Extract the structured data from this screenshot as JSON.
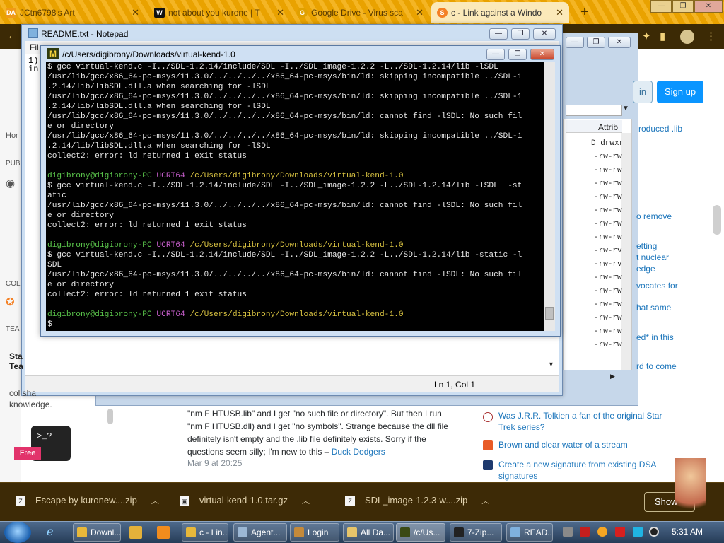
{
  "browser": {
    "tabs": [
      {
        "label": "JCtn6798's Art",
        "icon": "deviantart-icon"
      },
      {
        "label": "not about you kurone | T",
        "icon": "wix-icon"
      },
      {
        "label": "Google Drive - Virus sca",
        "icon": "google-drive-icon"
      },
      {
        "label": "c - Link against a Windo",
        "icon": "stackoverflow-icon"
      }
    ],
    "new_tab": "+"
  },
  "stackoverflow": {
    "login": "in",
    "signup": "Sign up",
    "left_nav": [
      "Hor",
      "PUB",
      "COL",
      "TEA"
    ],
    "right_snippets": [
      "roduced .lib",
      "o remove",
      "etting",
      "t nuclear",
      "edge",
      "vocates for",
      "hat same",
      "ed* in this",
      "rd to come"
    ],
    "comment": {
      "text": "\"nm F HTUSB.lib\" and I get \"no such file or directory\". But then I run \"nm F HTUSB.dll) and I get \"no symbols\". Strange because the dll file definitely isn't empty and the .lib file definitely exists. Sorry if the questions seem silly; I'm new to this –",
      "user": "Duck Dodgers",
      "time": "Mar 9 at 20:25"
    },
    "hot_questions": [
      "Was J.R.R. Tolkien a fan of the original Star Trek series?",
      "Brown and clear water of a stream",
      "Create a new signature from existing DSA signatures"
    ],
    "teams_ad": {
      "title_line1": "Sta",
      "title_line2": "Tea",
      "text": "col sha knowledge.",
      "badge": "Free",
      "prompt": ">_?"
    }
  },
  "explorer": {
    "column_header": "Attrib",
    "attributes": [
      "D drwxr",
      "-rw-rw",
      "-rw-rw",
      "-rw-rw",
      "-rw-rw",
      "-rw-rw",
      "-rw-rw",
      "-rw-rw",
      "-rw-rv",
      "-rw-rv",
      "-rw-rw",
      "-rw-rw",
      "-rw-rw",
      "-rw-rw",
      "-rw-rw",
      "-rw-rw"
    ]
  },
  "notepad": {
    "title": "README.txt - Notepad",
    "menu": "Fil",
    "content_line1": "1)",
    "content_line2": "in",
    "status": "Ln 1, Col 1"
  },
  "terminal": {
    "title": "/c/Users/digibrony/Downloads/virtual-kend-1.0",
    "lines": [
      {
        "t": "cmd",
        "text": "$ gcc virtual-kend.c -I../SDL-1.2.14/include/SDL -I../SDL_image-1.2.2 -L../SDL-1.2.14/lib -lSDL"
      },
      {
        "t": "cmd",
        "text": "/usr/lib/gcc/x86_64-pc-msys/11.3.0/../../../../x86_64-pc-msys/bin/ld: skipping incompatible ../SDL-1"
      },
      {
        "t": "cmd",
        "text": ".2.14/lib/libSDL.dll.a when searching for -lSDL"
      },
      {
        "t": "cmd",
        "text": "/usr/lib/gcc/x86_64-pc-msys/11.3.0/../../../../x86_64-pc-msys/bin/ld: skipping incompatible ../SDL-1"
      },
      {
        "t": "cmd",
        "text": ".2.14/lib/libSDL.dll.a when searching for -lSDL"
      },
      {
        "t": "cmd",
        "text": "/usr/lib/gcc/x86_64-pc-msys/11.3.0/../../../../x86_64-pc-msys/bin/ld: cannot find -lSDL: No such fil"
      },
      {
        "t": "cmd",
        "text": "e or directory"
      },
      {
        "t": "cmd",
        "text": "/usr/lib/gcc/x86_64-pc-msys/11.3.0/../../../../x86_64-pc-msys/bin/ld: skipping incompatible ../SDL-1"
      },
      {
        "t": "cmd",
        "text": ".2.14/lib/libSDL.dll.a when searching for -lSDL"
      },
      {
        "t": "cmd",
        "text": "collect2: error: ld returned 1 exit status"
      },
      {
        "t": "blank",
        "text": ""
      },
      {
        "t": "prompt",
        "user": "digibrony@digibrony-PC",
        "env": "UCRT64",
        "path": "/c/Users/digibrony/Downloads/virtual-kend-1.0"
      },
      {
        "t": "cmd",
        "text": "$ gcc virtual-kend.c -I../SDL-1.2.14/include/SDL -I../SDL_image-1.2.2 -L../SDL-1.2.14/lib -lSDL  -st"
      },
      {
        "t": "cmd",
        "text": "atic"
      },
      {
        "t": "cmd",
        "text": "/usr/lib/gcc/x86_64-pc-msys/11.3.0/../../../../x86_64-pc-msys/bin/ld: cannot find -lSDL: No such fil"
      },
      {
        "t": "cmd",
        "text": "e or directory"
      },
      {
        "t": "cmd",
        "text": "collect2: error: ld returned 1 exit status"
      },
      {
        "t": "blank",
        "text": ""
      },
      {
        "t": "prompt",
        "user": "digibrony@digibrony-PC",
        "env": "UCRT64",
        "path": "/c/Users/digibrony/Downloads/virtual-kend-1.0"
      },
      {
        "t": "cmd",
        "text": "$ gcc virtual-kend.c -I../SDL-1.2.14/include/SDL -I../SDL_image-1.2.2 -L../SDL-1.2.14/lib -static -l"
      },
      {
        "t": "cmd",
        "text": "SDL"
      },
      {
        "t": "cmd",
        "text": "/usr/lib/gcc/x86_64-pc-msys/11.3.0/../../../../x86_64-pc-msys/bin/ld: cannot find -lSDL: No such fil"
      },
      {
        "t": "cmd",
        "text": "e or directory"
      },
      {
        "t": "cmd",
        "text": "collect2: error: ld returned 1 exit status"
      },
      {
        "t": "blank",
        "text": ""
      },
      {
        "t": "prompt",
        "user": "digibrony@digibrony-PC",
        "env": "UCRT64",
        "path": "/c/Users/digibrony/Downloads/virtual-kend-1.0"
      },
      {
        "t": "cmd",
        "text": "$ "
      }
    ]
  },
  "downloads": {
    "items": [
      {
        "name": "Escape by kuronew....zip",
        "icon": "zip-icon"
      },
      {
        "name": "virtual-kend-1.0.tar.gz",
        "icon": "archive-icon"
      },
      {
        "name": "SDL_image-1.2.3-w....zip",
        "icon": "zip-icon"
      }
    ],
    "show_all": "Show"
  },
  "taskbar": {
    "items": [
      {
        "label": "Downl...",
        "icon": "chrome-icon"
      },
      {
        "label": "c - Lin...",
        "icon": "chrome-icon"
      },
      {
        "label": "Agent...",
        "icon": "agent-icon"
      },
      {
        "label": "Login",
        "icon": "login-icon"
      },
      {
        "label": "All Da...",
        "icon": "folder-icon"
      },
      {
        "label": "/c/Us...",
        "icon": "msys-icon"
      },
      {
        "label": "7-Zip...",
        "icon": "7zip-icon"
      },
      {
        "label": "READ...",
        "icon": "notepad-icon"
      }
    ],
    "clock": "5:31 AM"
  }
}
